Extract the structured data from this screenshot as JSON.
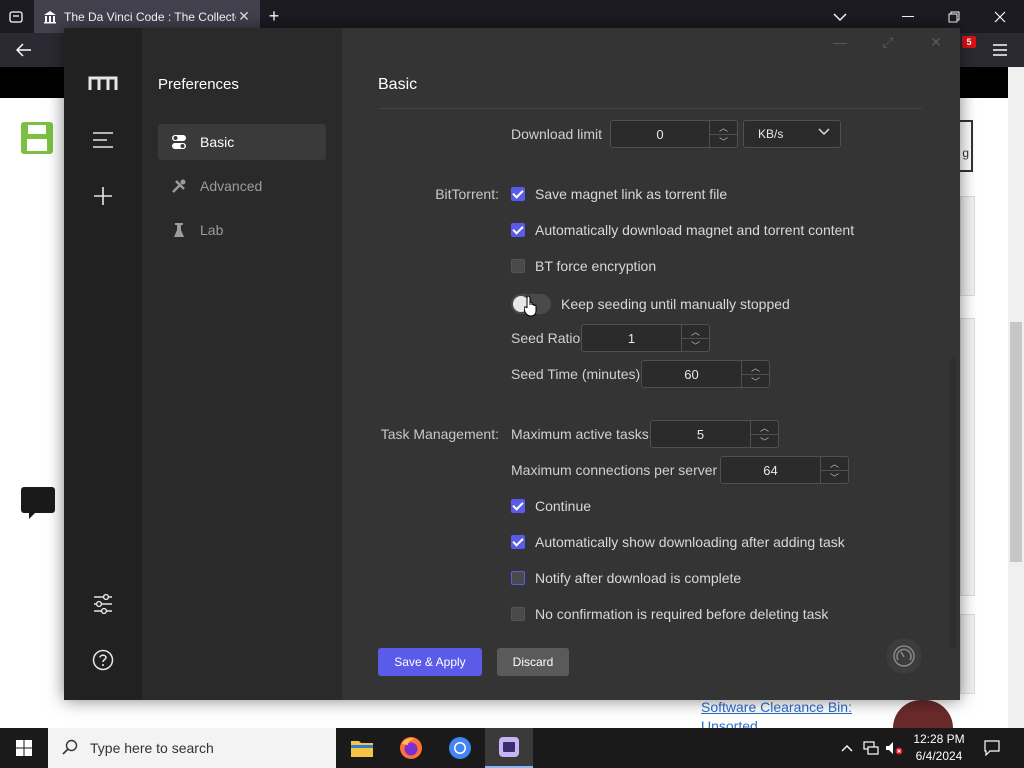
{
  "browser": {
    "tab_title": "The Da Vinci Code : The Collecte",
    "extension_badge": "5"
  },
  "page": {
    "link_text": "Software Clearance Bin:",
    "link_text_2": "Unsorted",
    "box_text": "g"
  },
  "app": {
    "sidebar_title": "Preferences",
    "nav": [
      {
        "label": "Basic",
        "icon": "toggle-icon",
        "active": true
      },
      {
        "label": "Advanced",
        "icon": "tools-icon",
        "active": false
      },
      {
        "label": "Lab",
        "icon": "flask-icon",
        "active": false
      }
    ],
    "main_title": "Basic",
    "download_limit": {
      "label": "Download limit",
      "value": "0",
      "unit": "KB/s"
    },
    "bittorrent": {
      "section_label": "BitTorrent:",
      "save_magnet": "Save magnet link as torrent file",
      "auto_download": "Automatically download magnet and torrent content",
      "force_encryption": "BT force encryption",
      "keep_seeding": "Keep seeding until manually stopped",
      "seed_ratio_label": "Seed Ratio",
      "seed_ratio_value": "1",
      "seed_time_label": "Seed Time (minutes)",
      "seed_time_value": "60"
    },
    "task_management": {
      "section_label": "Task Management:",
      "max_active_label": "Maximum active tasks",
      "max_active_value": "5",
      "max_conn_label": "Maximum connections per server",
      "max_conn_value": "64",
      "continue": "Continue",
      "auto_show": "Automatically show downloading after adding task",
      "notify": "Notify after download is complete",
      "no_confirm": "No confirmation is required before deleting task"
    },
    "save_label": "Save & Apply",
    "discard_label": "Discard",
    "accent_color": "#5b5bea"
  },
  "taskbar": {
    "search_placeholder": "Type here to search",
    "time": "12:28 PM",
    "date": "6/4/2024"
  }
}
